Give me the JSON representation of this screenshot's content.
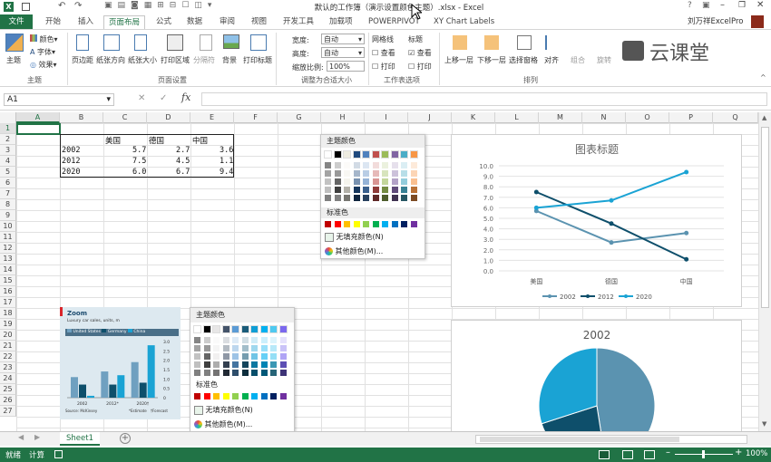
{
  "window": {
    "title": "默认的工作簿（演示设置颜色主题）.xlsx - Excel",
    "help": "?"
  },
  "tabs": [
    {
      "label": "文件"
    },
    {
      "label": "开始"
    },
    {
      "label": "插入"
    },
    {
      "label": "页面布局"
    },
    {
      "label": "公式"
    },
    {
      "label": "数据"
    },
    {
      "label": "审阅"
    },
    {
      "label": "视图"
    },
    {
      "label": "开发工具"
    },
    {
      "label": "加载项"
    },
    {
      "label": "POWERPIVOT"
    },
    {
      "label": "XY Chart Labels"
    }
  ],
  "user": "刘万祥ExcelPro",
  "ribbon": {
    "themes": "主题",
    "colors": "颜色",
    "fonts": "字体",
    "effects": "效果",
    "margins": "页边距",
    "orientation": "纸张方向",
    "size": "纸张大小",
    "print_area": "打印区域",
    "breaks": "分隔符",
    "background": "背景",
    "print_titles": "打印标题",
    "width_label": "宽度:",
    "width_value": "自动",
    "height_label": "高度:",
    "height_value": "自动",
    "scale_label": "缩放比例:",
    "scale_value": "100%",
    "gridlines": "网格线",
    "headings": "标题",
    "view1": "查看",
    "view2": "查看",
    "print1": "打印",
    "print2": "打印",
    "bring_forward": "上移一层",
    "send_backward": "下移一层",
    "selection_pane": "选择窗格",
    "align": "对齐",
    "group": "组合",
    "rotate": "旋转",
    "g_theme": "主题",
    "g_page": "页面设置",
    "g_scale": "调整为合适大小",
    "g_sheet": "工作表选项",
    "g_arrange": "排列"
  },
  "watermark": "云课堂",
  "formula": {
    "namebox": "A1",
    "fx": "fx",
    "cancel": "✕",
    "enter": "✓",
    "value": ""
  },
  "columns": [
    "A",
    "B",
    "C",
    "D",
    "E",
    "F",
    "G",
    "H",
    "I",
    "J",
    "K",
    "L",
    "M",
    "N",
    "O",
    "P",
    "Q"
  ],
  "rows": [
    "1",
    "2",
    "3",
    "4",
    "5",
    "6",
    "7",
    "8",
    "9",
    "10",
    "11",
    "12",
    "13",
    "14",
    "15",
    "16",
    "17",
    "18",
    "19",
    "20",
    "21",
    "22",
    "23",
    "24",
    "25",
    "26",
    "27"
  ],
  "table": {
    "headers": [
      "美国",
      "德国",
      "中国"
    ],
    "rows": [
      {
        "year": "2002",
        "v": [
          "5.7",
          "2.7",
          "3.6"
        ]
      },
      {
        "year": "2012",
        "v": [
          "7.5",
          "4.5",
          "1.1"
        ]
      },
      {
        "year": "2020",
        "v": [
          "6.0",
          "6.7",
          "9.4"
        ]
      }
    ]
  },
  "palette": {
    "theme_label": "主题颜色",
    "standard_label": "标准色",
    "no_fill": "无填充颜色(N)",
    "more": "其他颜色(M)...",
    "theme_top": [
      "#ffffff",
      "#000000",
      "#eeece1",
      "#1f497d",
      "#4f81bd",
      "#c0504d",
      "#9bbb59",
      "#8064a2",
      "#4bacc6",
      "#f79646"
    ],
    "standard": [
      "#c00000",
      "#ff0000",
      "#ffc000",
      "#ffff00",
      "#92d050",
      "#00b050",
      "#00b0f0",
      "#0070c0",
      "#002060",
      "#7030a0"
    ]
  },
  "palette2": {
    "theme_label": "主题颜色",
    "standard_label": "标准色",
    "no_fill": "无填充颜色(N)",
    "more": "其他颜色(M)...",
    "theme_top": [
      "#ffffff",
      "#000000",
      "#e7e6e6",
      "#44546a",
      "#5b9bd5",
      "#1a5c7a",
      "#0f9ed5",
      "#00b0f0",
      "#4ec9f0",
      "#7b68ee"
    ],
    "standard": [
      "#c00000",
      "#ff0000",
      "#ffc000",
      "#ffff00",
      "#92d050",
      "#00b050",
      "#00b0f0",
      "#0070c0",
      "#002060",
      "#7030a0"
    ]
  },
  "zoom_card": {
    "title": "Zoom",
    "subtitle": "Luxury car sales, units, m",
    "legend": [
      "United States",
      "Germany",
      "China"
    ],
    "categories": [
      "2002",
      "2012*",
      "2020†"
    ],
    "source": "Source: McKinsey",
    "notes": [
      "*Estimate",
      "†Forecast"
    ],
    "yticks": [
      "3.0",
      "2.5",
      "2.0",
      "1.5",
      "1.0",
      "0.5",
      "0"
    ]
  },
  "sheet_tab": "Sheet1",
  "status": {
    "ready": "就绪",
    "calc": "计算",
    "zoom": "100%"
  },
  "colors": {
    "excel_green": "#217346",
    "s2002": "#5b93b0",
    "s2012": "#0e4f6b",
    "s2020": "#1aa3d4"
  },
  "chart_data": [
    {
      "type": "line",
      "title": "图表标题",
      "categories": [
        "美国",
        "德国",
        "中国"
      ],
      "series": [
        {
          "name": "2002",
          "values": [
            5.7,
            2.7,
            3.6
          ]
        },
        {
          "name": "2012",
          "values": [
            7.5,
            4.5,
            1.1
          ]
        },
        {
          "name": "2020",
          "values": [
            6.0,
            6.7,
            9.4
          ]
        }
      ],
      "ylim": [
        0,
        10
      ],
      "yticks": [
        "10.0",
        "9.0",
        "8.0",
        "7.0",
        "6.0",
        "5.0",
        "4.0",
        "3.0",
        "2.0",
        "1.0",
        "0.0"
      ],
      "grid": true,
      "legend": "bottom"
    },
    {
      "type": "pie",
      "title": "2002",
      "categories": [
        "美国",
        "德国",
        "中国"
      ],
      "values": [
        5.7,
        2.7,
        3.6
      ]
    },
    {
      "type": "bar",
      "title": "Zoom",
      "categories": [
        "2002",
        "2012*",
        "2020†"
      ],
      "series": [
        {
          "name": "United States",
          "values": [
            1.1,
            1.4,
            1.9
          ]
        },
        {
          "name": "Germany",
          "values": [
            0.7,
            0.7,
            0.8
          ]
        },
        {
          "name": "China",
          "values": [
            0.1,
            1.2,
            2.8
          ]
        }
      ],
      "ylim": [
        0,
        3.0
      ]
    }
  ]
}
